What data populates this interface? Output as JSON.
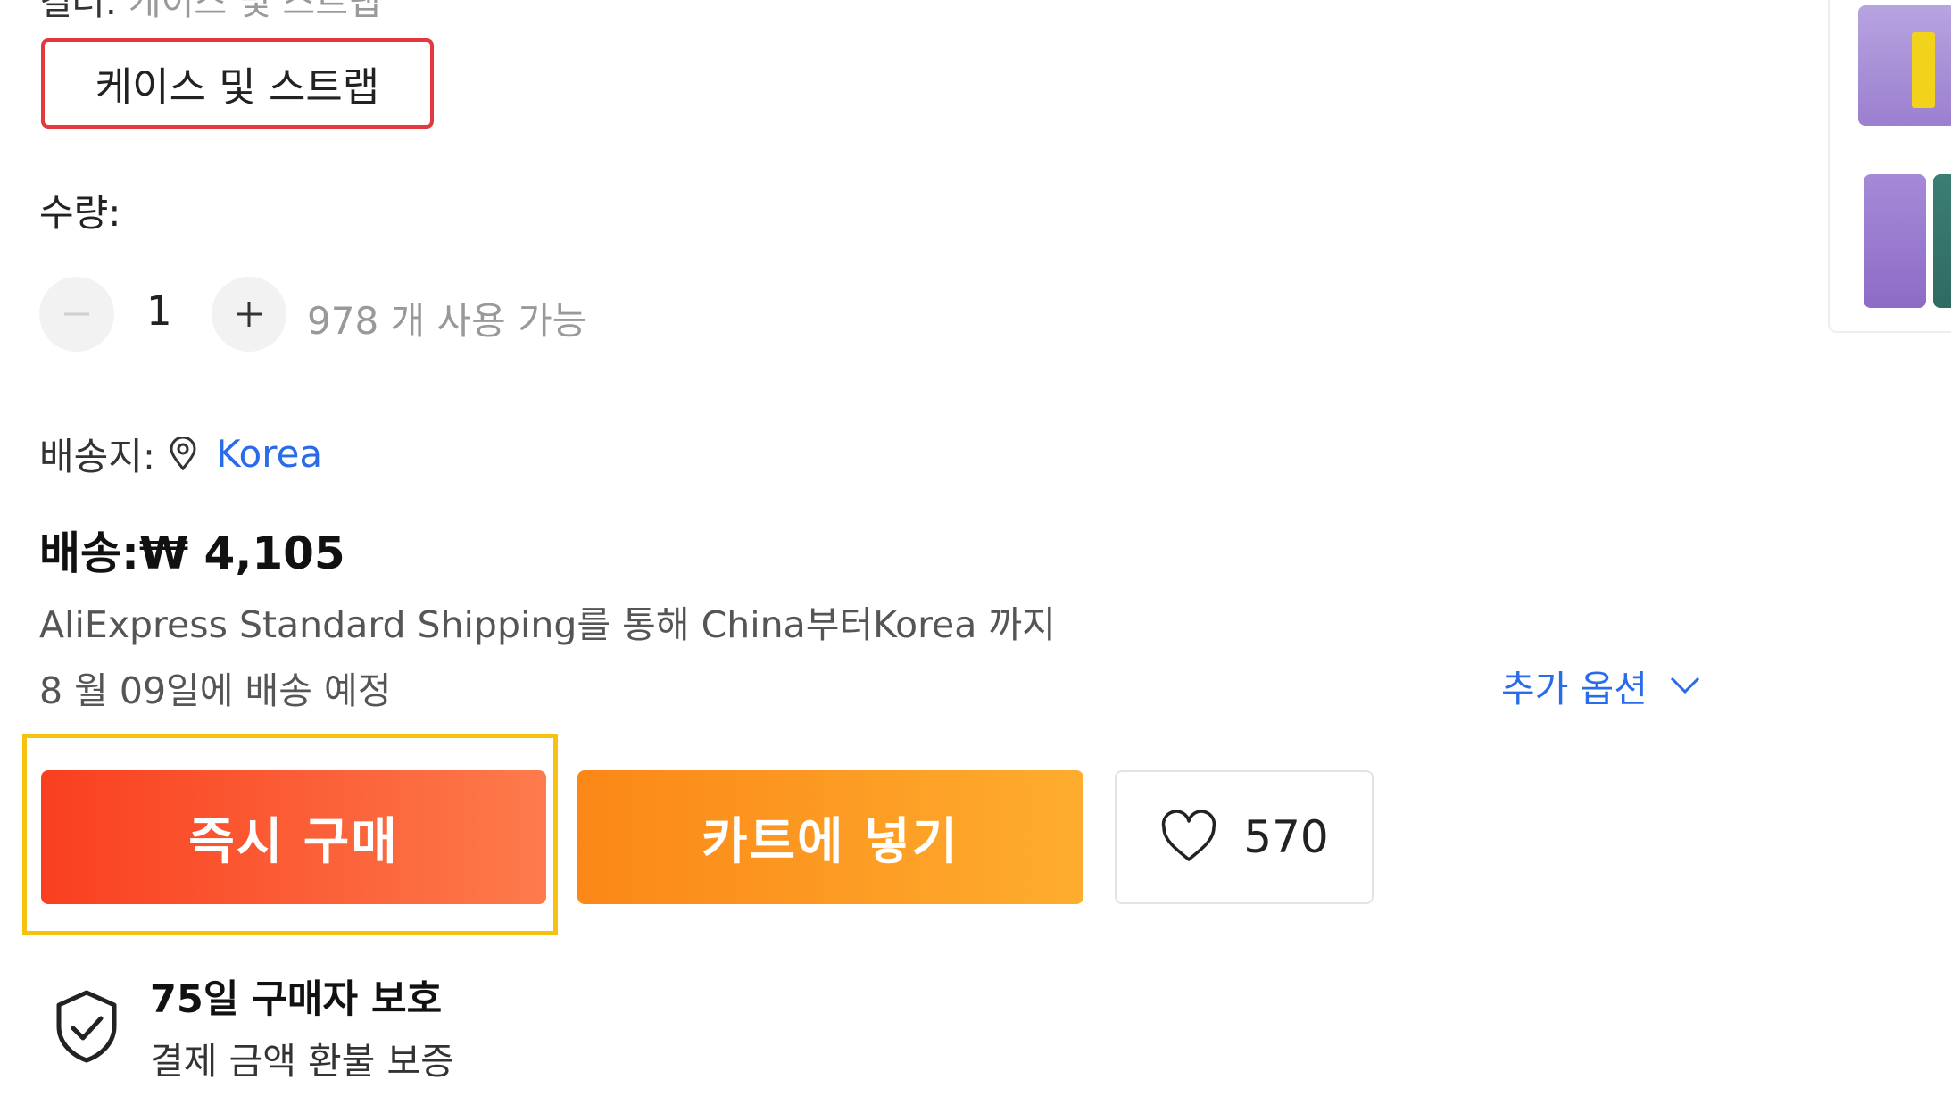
{
  "variant": {
    "cut_label": "컬러:",
    "cut_value": "케이스 및 스트랩",
    "selected_option": "케이스 및 스트랩",
    "selected_border_color": "#e4393c"
  },
  "quantity": {
    "label": "수량:",
    "value": "1",
    "minus_symbol": "−",
    "plus_symbol": "+",
    "available_text": "978 개 사용 가능"
  },
  "shipping": {
    "ship_to_label": "배송지:",
    "pin_icon": "location-pin-icon",
    "country": "Korea",
    "price_text": "배송:₩ 4,105",
    "method_text": "AliExpress Standard Shipping를 통해 China부터Korea 까지",
    "delivery_text": "8 월 09일에 배송 예정",
    "more_options_label": "추가 옵션",
    "chevron_icon": "chevron-down-icon",
    "link_color": "#2a6be9"
  },
  "actions": {
    "buy_now_label": "즉시 구매",
    "add_to_cart_label": "카트에 넣기",
    "wishlist_icon": "heart-icon",
    "wishlist_count": "570",
    "buy_color": "#f93f1f",
    "cart_color": "#fb8717",
    "highlight_color": "#f7c10f"
  },
  "protection": {
    "icon": "shield-check-icon",
    "title": "75일 구매자 보호",
    "subtitle": "결제 금액 환불 보증"
  },
  "thumbnails": {
    "colors": [
      "#9b7fd0",
      "#8d6cc6",
      "#2f6b63"
    ]
  }
}
